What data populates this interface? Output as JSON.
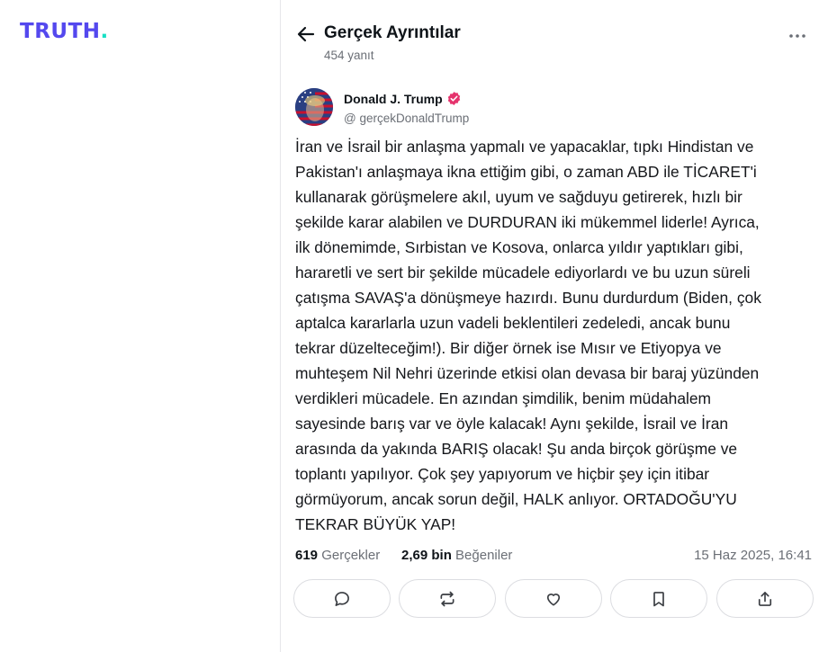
{
  "brand": {
    "logo_text": "TRUTH",
    "logo_dot": ".",
    "accent": "#5448ee",
    "dot_color": "#17e0c4"
  },
  "header": {
    "title": "Gerçek Ayrıntılar",
    "subtitle": "454 yanıt",
    "back_icon": "arrow-left-icon",
    "more_icon": "more-horizontal-icon"
  },
  "post": {
    "author": {
      "name": "Donald J. Trump",
      "handle": "@ gerçekDonaldTrump",
      "verified": true,
      "verified_color": "#e5336d"
    },
    "text": "İran ve İsrail bir anlaşma yapmalı ve yapacaklar, tıpkı Hindistan ve\nPakistan'ı anlaşmaya ikna ettiğim gibi, o zaman ABD ile TİCARET'i\nkullanarak görüşmelere akıl, uyum ve sağduyu getirerek, hızlı bir\nşekilde karar alabilen ve DURDURAN iki mükemmel liderle! Ayrıca,\nilk dönemimde, Sırbistan ve Kosova, onlarca yıldır yaptıkları gibi,\nhararetli ve sert bir şekilde mücadele ediyorlardı ve bu uzun süreli\nçatışma SAVAŞ'a dönüşmeye hazırdı. Bunu durdurdum (Biden, çok\naptalca kararlarla uzun vadeli beklentileri zedeledi, ancak bunu\ntekrar düzelteceğim!). Bir diğer örnek ise Mısır ve Etiyopya ve\nmuhteşem Nil Nehri üzerinde etkisi olan devasa bir baraj yüzünden\nverdikleri mücadele. En azından şimdilik, benim müdahalem\nsayesinde barış var ve öyle kalacak! Aynı şekilde, İsrail ve İran\narasında da yakında BARIŞ olacak! Şu anda birçok görüşme ve\ntoplantı yapılıyor. Çok şey yapıyorum ve hiçbir şey için itibar\ngörmüyorum, ancak sorun değil, HALK anlıyor. ORTADOĞU'YU\nTEKRAR BÜYÜK YAP!",
    "stats": {
      "retruths_count": "619",
      "retruths_label": "Gerçekler",
      "likes_count": "2,69 bin",
      "likes_label": "Beğeniler",
      "timestamp": "15 Haz 2025, 16:41"
    },
    "actions": [
      {
        "name": "reply",
        "icon": "chat-bubble-icon"
      },
      {
        "name": "retruth",
        "icon": "repost-icon"
      },
      {
        "name": "like",
        "icon": "heart-icon"
      },
      {
        "name": "bookmark",
        "icon": "bookmark-icon"
      },
      {
        "name": "share",
        "icon": "share-icon"
      }
    ]
  }
}
